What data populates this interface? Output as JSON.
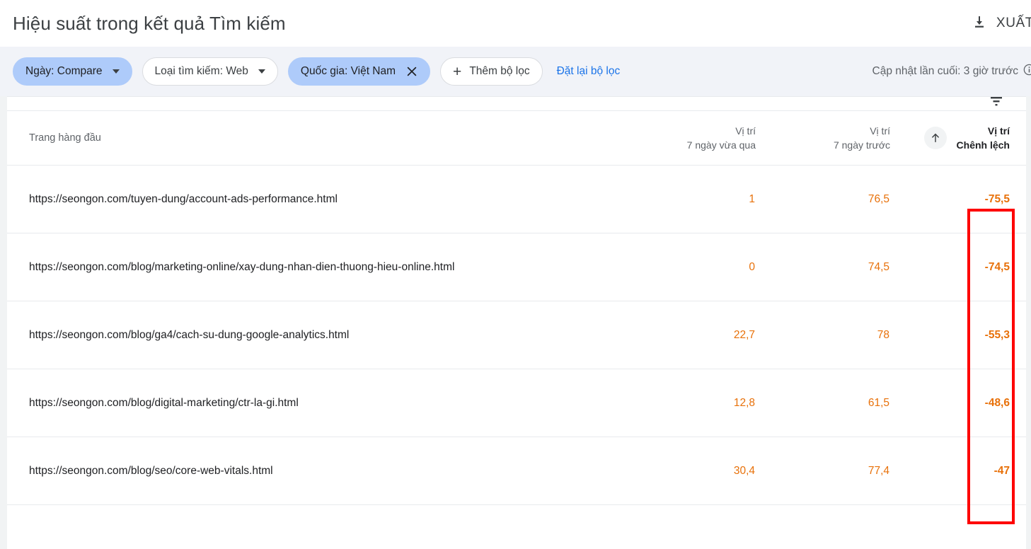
{
  "header": {
    "title": "Hiệu suất trong kết quả Tìm kiếm",
    "export_label": "XUẤT",
    "export_icon": "download-icon"
  },
  "filters": {
    "chips": [
      {
        "label": "Ngày: Compare",
        "active": true,
        "control": "dropdown"
      },
      {
        "label": "Loại tìm kiếm: Web",
        "active": false,
        "control": "dropdown"
      },
      {
        "label": "Quốc gia: Việt Nam",
        "active": true,
        "control": "remove"
      },
      {
        "label": "Thêm bộ lọc",
        "active": false,
        "control": "add"
      }
    ],
    "reset_label": "Đặt lại bộ lọc",
    "last_update": "Cập nhật lần cuối: 3 giờ trước",
    "info_icon": "info-icon"
  },
  "table": {
    "filter_icon": "filter-funnel-icon",
    "sort_icon": "sort-ascending-arrow-icon",
    "columns": {
      "page": "Trang hàng đầu",
      "current": {
        "line1": "Vị trí",
        "line2": "7 ngày vừa qua"
      },
      "previous": {
        "line1": "Vị trí",
        "line2": "7 ngày trước"
      },
      "diff": {
        "line1": "Vị trí",
        "line2": "Chênh lệch"
      }
    },
    "rows": [
      {
        "page": "https://seongon.com/tuyen-dung/account-ads-performance.html",
        "current": "1",
        "previous": "76,5",
        "diff": "-75,5"
      },
      {
        "page": "https://seongon.com/blog/marketing-online/xay-dung-nhan-dien-thuong-hieu-online.html",
        "current": "0",
        "previous": "74,5",
        "diff": "-74,5"
      },
      {
        "page": "https://seongon.com/blog/ga4/cach-su-dung-google-analytics.html",
        "current": "22,7",
        "previous": "78",
        "diff": "-55,3"
      },
      {
        "page": "https://seongon.com/blog/digital-marketing/ctr-la-gi.html",
        "current": "12,8",
        "previous": "61,5",
        "diff": "-48,6"
      },
      {
        "page": "https://seongon.com/blog/seo/core-web-vitals.html",
        "current": "30,4",
        "previous": "77,4",
        "diff": "-47"
      }
    ]
  },
  "annotation": {
    "shape": "rectangle-highlight",
    "color": "#fe0000",
    "target_column": "Vị trí Chênh lệch"
  },
  "colors": {
    "accent_blue": "#1a73e8",
    "chip_active": "#aecbfa",
    "metric_orange": "#e8710a",
    "annotation_red": "#fe0000",
    "page_background": "#f1f3f8"
  }
}
